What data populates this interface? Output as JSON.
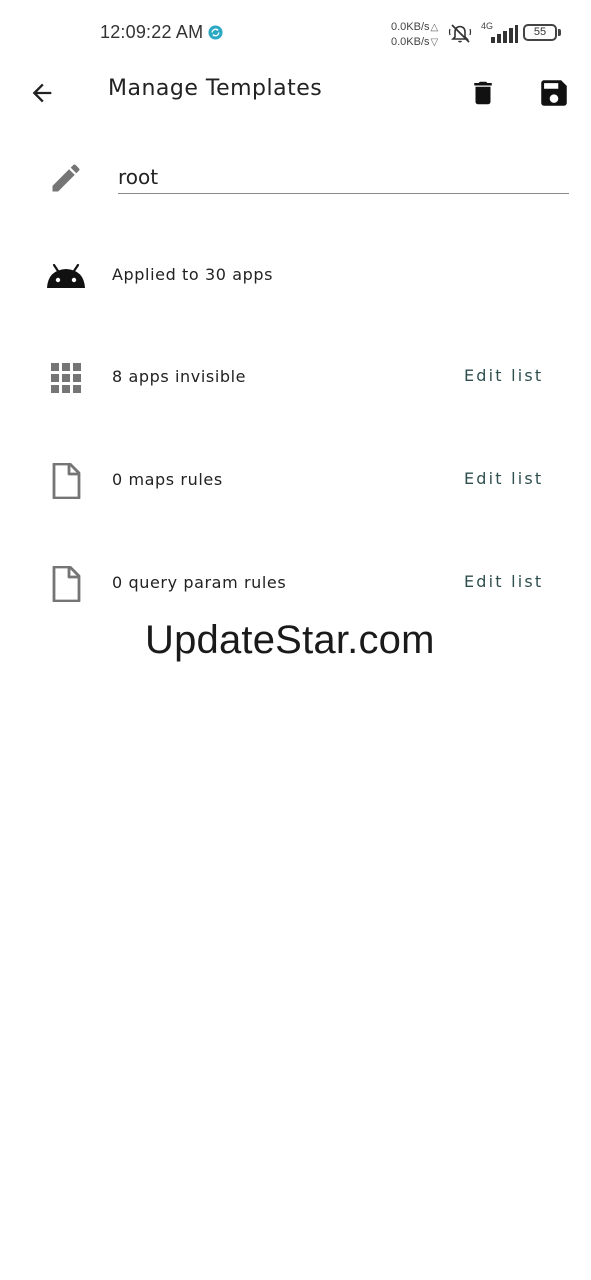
{
  "status_bar": {
    "time": "12:09:22 AM",
    "upload_speed": "0.0KB/s",
    "download_speed": "0.0KB/s",
    "network_type": "4G",
    "battery_level": "55",
    "icons": [
      "sync-icon",
      "mute-icon",
      "signal-icon",
      "battery-icon"
    ]
  },
  "app_bar": {
    "title": "Manage Templates",
    "icons": [
      "back-arrow-icon",
      "delete-icon",
      "save-icon"
    ]
  },
  "name_field": {
    "value": "root",
    "icon": "pencil-icon"
  },
  "rows": [
    {
      "icon": "android-icon",
      "text": "Applied to 30 apps",
      "action": ""
    },
    {
      "icon": "apps-grid-icon",
      "text": "8 apps invisible",
      "action": "Edit list"
    },
    {
      "icon": "file-icon",
      "text": "0 maps rules",
      "action": "Edit list"
    },
    {
      "icon": "file-icon",
      "text": "0 query param rules",
      "action": "Edit list"
    }
  ],
  "watermark": "UpdateStar.com",
  "colors": {
    "icon_gray": "#757575",
    "action_text": "#2f4f4f",
    "sync_accent": "#2aa8c4"
  }
}
